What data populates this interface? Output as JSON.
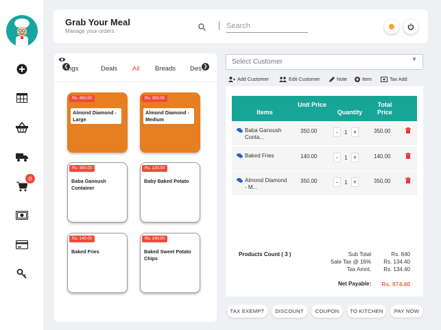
{
  "header": {
    "title": "Grab Your Meal",
    "subtitle": "Manage your orders",
    "search_placeholder": "Search",
    "status_color": "#f5a623"
  },
  "sidebar": {
    "cart_badge": "0",
    "items": [
      "add-icon",
      "table-grid-icon",
      "basket-icon",
      "delivery-truck-icon",
      "cart-icon",
      "cash-icon",
      "card-icon",
      "key-icon"
    ]
  },
  "categories": {
    "tabs": [
      "ings",
      "Deals",
      "All",
      "Breads",
      "Des"
    ],
    "active": "All"
  },
  "products": [
    {
      "price": "Rs. 450.00",
      "name": "Almond Diamond - Large",
      "selected": true
    },
    {
      "price": "Rs. 350.00",
      "name": "Almond Diamond - Medium",
      "selected": true
    },
    {
      "price": "Rs. 350.00",
      "name": "Baba Ganoush Container",
      "selected": false
    },
    {
      "price": "Rs. 120.00",
      "name": "Baby Baked Potato",
      "selected": false
    },
    {
      "price": "Rs. 140.00",
      "name": "Baked Fries",
      "selected": false
    },
    {
      "price": "Rs. 140.00",
      "name": "Baked Sweet Potato Chips",
      "selected": false
    }
  ],
  "customer": {
    "placeholder": "Select Customer"
  },
  "actions": {
    "add_customer": "Add Customer",
    "edit_customer": "Edit Customer",
    "note": "Note",
    "item": "Item",
    "tax_add": "Tax Add"
  },
  "order": {
    "headers": {
      "items": "Items",
      "unit_price": "Unit Price",
      "quantity": "Quantity",
      "total_price": "Total Price"
    },
    "rows": [
      {
        "name": "Baba Ganoush Conta...",
        "unit": "350.00",
        "qty": "1",
        "total": "350.00"
      },
      {
        "name": "Baked Fries",
        "unit": "140.00",
        "qty": "1",
        "total": "140.00"
      },
      {
        "name": "Almond Diamond - M...",
        "unit": "350.00",
        "qty": "1",
        "total": "350.00"
      }
    ],
    "products_count": "Products Count ( 3 )",
    "sub_total_label": "Sub Total",
    "sub_total": "Rs. 840",
    "sale_tax_label": "Sale Tax @ 16%",
    "sale_tax": "Rs. 134.40",
    "tax_amnt_label": "Tax Amnt.",
    "tax_amnt": "Rs. 134.40",
    "net_payable_label": "Net Payable:",
    "net_payable": "Rs. 974.40"
  },
  "buttons": {
    "tax_exempt": "TAX EXEMPT",
    "discount": "DISCOUNT",
    "coupon": "COUPON",
    "to_kitchen": "TO KITCHEN",
    "pay_now": "PAY NOW"
  },
  "colors": {
    "accent_teal": "#17a596",
    "orange": "#e67e22",
    "red": "#f04a3a"
  }
}
